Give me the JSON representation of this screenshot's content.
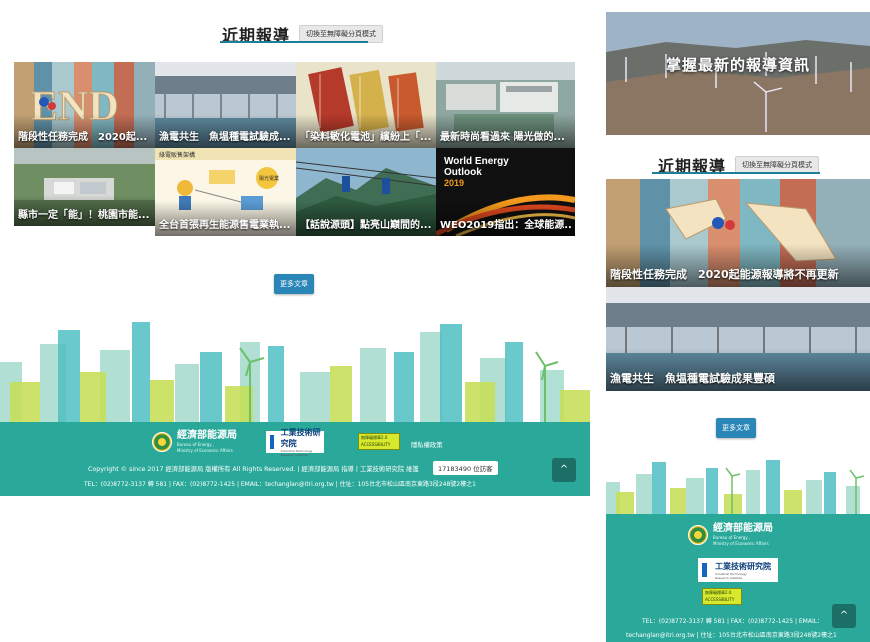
{
  "desktop": {
    "section_title": "近期報導",
    "toggle_label": "切換至無障礙分頁模式",
    "cards": [
      {
        "caption": "階段性任務完成　2020起..."
      },
      {
        "caption": "漁電共生　魚塭種電試驗成..."
      },
      {
        "caption": "「染料敏化電池」繽紛上「..."
      },
      {
        "caption": "最新時尚看過來 陽光做的..."
      },
      {
        "caption": "縣市一定「能」！桃園市能..."
      },
      {
        "caption": "全台首張再生能源售電業執..."
      },
      {
        "caption": "【話說源頭】點亮山巔間的..."
      },
      {
        "caption": "WEO2019指出：全球能源..."
      }
    ],
    "card_overlays": {
      "end_letters": "END",
      "diagram_title": "綠電販售架構",
      "diagram_sub": "陽光電業"
    },
    "weo_overlay": {
      "line1": "World Energy",
      "line2": "Outlook",
      "line3": "2019"
    },
    "more_label": "更多文章",
    "footer": {
      "ebea_zh": "經濟部能源局",
      "ebea_en1": "Bureau of Energy ,",
      "ebea_en2": "Ministry of Economic Affairs",
      "itri_zh": "工業技術研究院",
      "itri_en1": "Industrial Technology",
      "itri_en2": "Research Institute",
      "acc_line1": "無障礙標章2.0",
      "acc_line2": "ACCESSIBILITY",
      "privacy": "隱私權政策",
      "copyright": "Copyright © since 2017 經濟部能源局 版權所有 All Rights Reserved. | 經濟部能源局 指導 | 工業技術研究院 維護",
      "counter": "17183490 位訪客",
      "contact": "TEL：(02)8772-3137 轉 581 | FAX：(02)8772-1425 | EMAIL：techanglan@itri.org.tw | 住址：105台北市松山區南京東路3段248號2樓之1",
      "totop": "^"
    }
  },
  "mobile": {
    "banner_text": "掌握最新的報導資訊",
    "section_title": "近期報導",
    "toggle_label": "切換至無障礙分頁模式",
    "cards": [
      {
        "caption": "階段性任務完成　2020起能源報導將不再更新"
      },
      {
        "caption": "漁電共生　魚塭種電試驗成果豐碩"
      }
    ],
    "more_label": "更多文章",
    "footer": {
      "ebea_zh": "經濟部能源局",
      "ebea_en1": "Bureau of Energy ,",
      "ebea_en2": "Ministry of Economic Affairs",
      "itri_zh": "工業技術研究院",
      "itri_en1": "Industrial Technology",
      "itri_en2": "Research Institute",
      "acc_line1": "無障礙標章2.0",
      "acc_line2": "ACCESSIBILITY",
      "contact1": "TEL：(02)8772-3137 轉 581 | FAX：(02)8772-1425 | EMAIL：",
      "contact2": "techanglan@itri.org.tw | 住址：105台北市松山區南京東路3段248號2樓之1",
      "totop": "^"
    }
  },
  "colors": {
    "accent_line": "#1e7f98",
    "button_blue": "#2a86b7",
    "footer_teal": "#2aa89a",
    "totop_dark": "#1c6f66"
  },
  "icons": [
    "city-skyline-icon",
    "wind-turbine-icon",
    "chevron-up-icon",
    "ebea-seal-icon",
    "itri-logo-icon"
  ]
}
